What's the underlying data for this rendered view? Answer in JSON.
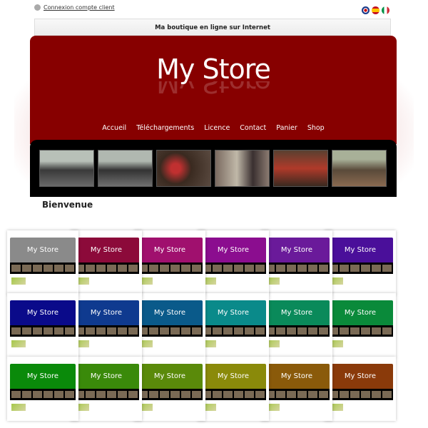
{
  "topbar": {
    "login_label": "Connexion compte client",
    "languages": [
      "English",
      "Español",
      "Italiano"
    ]
  },
  "title_bar": "Ma boutique en ligne sur Internet",
  "header": {
    "logo": "My Store",
    "color": "#870000"
  },
  "nav": [
    "Accueil",
    "Téléchargements",
    "Licence",
    "Contact",
    "Panier",
    "Shop"
  ],
  "photos": [
    "photo-1",
    "photo-2",
    "photo-3",
    "photo-4",
    "photo-5",
    "photo-6"
  ],
  "content": {
    "heading": "Bienvenue"
  },
  "themes": {
    "logo": "My Store",
    "colors": [
      "#8a8a8a",
      "#8c0a3a",
      "#a0106e",
      "#8b0d8f",
      "#6a1a9a",
      "#4a0f9a",
      "#0a0a8a",
      "#0f3a8f",
      "#0a5a8a",
      "#0a8a8a",
      "#0a8a5a",
      "#0a8a3a",
      "#0a8a0a",
      "#3a8a0a",
      "#5a8a0a",
      "#8a8a0a",
      "#8a5a0a",
      "#8a3a0a"
    ]
  }
}
